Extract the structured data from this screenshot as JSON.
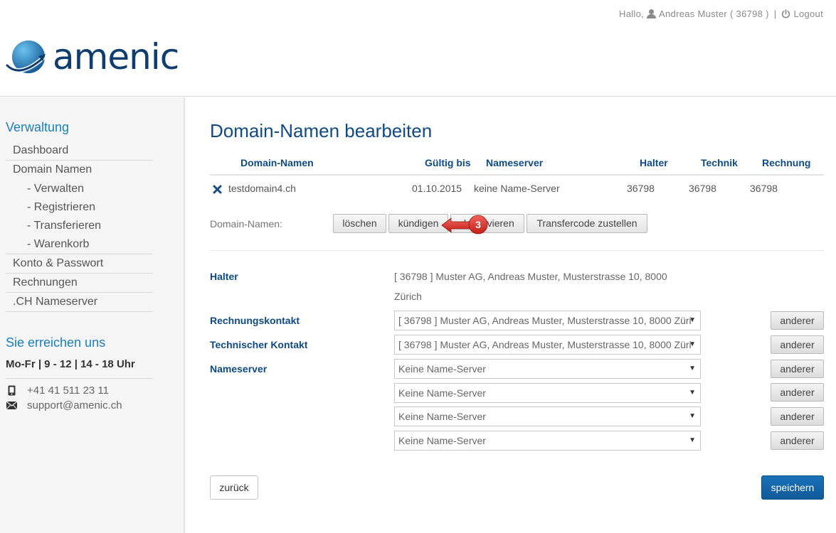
{
  "header": {
    "greeting": "Hallo,",
    "user_name": "Andreas Muster",
    "customer_id": "( 36798 )",
    "separator": "|",
    "logout_label": "Logout",
    "logo_text": "amenic",
    "colors": {
      "logo_dark": "#0e3d6e",
      "logo_accent": "#28a7e0"
    }
  },
  "sidebar": {
    "section_title": "Verwaltung",
    "items": [
      {
        "label": "Dashboard"
      },
      {
        "label": "Domain Namen"
      },
      {
        "label": "- Verwalten"
      },
      {
        "label": "- Registrieren"
      },
      {
        "label": "- Transferieren"
      },
      {
        "label": "- Warenkorb"
      },
      {
        "label": "Konto & Passwort"
      },
      {
        "label": "Rechnungen"
      },
      {
        "label": ".CH Nameserver"
      }
    ],
    "contact_title": "Sie erreichen uns",
    "hours": "Mo-Fr | 9 - 12 | 14 - 18 Uhr",
    "phone": "+41 41 511 23 11",
    "email": "support@amenic.ch"
  },
  "main": {
    "title": "Domain-Namen bearbeiten",
    "columns": [
      "Domain-Namen",
      "Gültig bis",
      "Nameserver",
      "Halter",
      "Technik",
      "Rechnung"
    ],
    "row": {
      "domain": "testdomain4.ch",
      "valid_until": "01.10.2015",
      "nameserver": "keine Name-Server",
      "holder": "36798",
      "tech": "36798",
      "billing": "36798"
    },
    "actions_label": "Domain-Namen:",
    "actions": {
      "delete": "löschen",
      "cancel": "kündigen",
      "deactivate": "deaktivieren",
      "transfer": "Transfercode zustellen"
    },
    "annotation_number": "3",
    "holder_label": "Halter",
    "holder_value": "[ 36798 ] Muster AG, Andreas Muster, Musterstrasse 10, 8000 Zürich",
    "billing_label": "Rechnungskontakt",
    "billing_value": "[ 36798 ] Muster AG, Andreas Muster, Musterstrasse 10, 8000 Züri",
    "tech_label": "Technischer Kontakt",
    "tech_value": "[ 36798 ] Muster AG, Andreas Muster, Musterstrasse 10, 8000 Züri",
    "ns_label": "Nameserver",
    "ns_values": [
      "Keine Name-Server",
      "Keine Name-Server",
      "Keine Name-Server",
      "Keine Name-Server"
    ],
    "other_label": "anderer",
    "back_label": "zurück",
    "save_label": "speichern",
    "colors": {
      "heading": "#0e4a85",
      "primary_button": "#1b72b8",
      "annotation": "#e0302a"
    }
  }
}
